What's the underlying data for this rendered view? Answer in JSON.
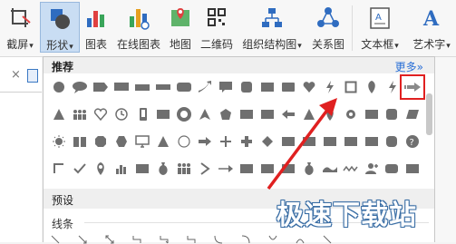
{
  "ribbon": {
    "items": [
      {
        "label": "截屏",
        "dropdown": true,
        "icon": "screenshot-icon"
      },
      {
        "label": "形状",
        "dropdown": true,
        "icon": "shapes-icon"
      },
      {
        "label": "图表",
        "icon": "chart-icon"
      },
      {
        "label": "在线图表",
        "icon": "online-chart-icon"
      },
      {
        "label": "地图",
        "icon": "map-icon"
      },
      {
        "label": "二维码",
        "icon": "qrcode-icon"
      },
      {
        "label": "组织结构图",
        "dropdown": true,
        "icon": "org-chart-icon"
      },
      {
        "label": "关系图",
        "icon": "relation-icon"
      },
      {
        "label": "文本框",
        "dropdown": true,
        "icon": "textbox-icon"
      },
      {
        "label": "艺术字",
        "dropdown": true,
        "icon": "wordart-icon"
      }
    ]
  },
  "dropdown_arrow": "▾",
  "doc_tab_close": "×",
  "panel": {
    "recommended_title": "推荐",
    "more_label": "更多»",
    "preset_title": "预设",
    "lines_label": "线条"
  },
  "watermark": "极速下载站",
  "colors": {
    "highlight": "#e02020",
    "accent": "#2a6fd6",
    "active_tab": "#c9ddf3",
    "shape_fill": "#6f6f6f"
  }
}
